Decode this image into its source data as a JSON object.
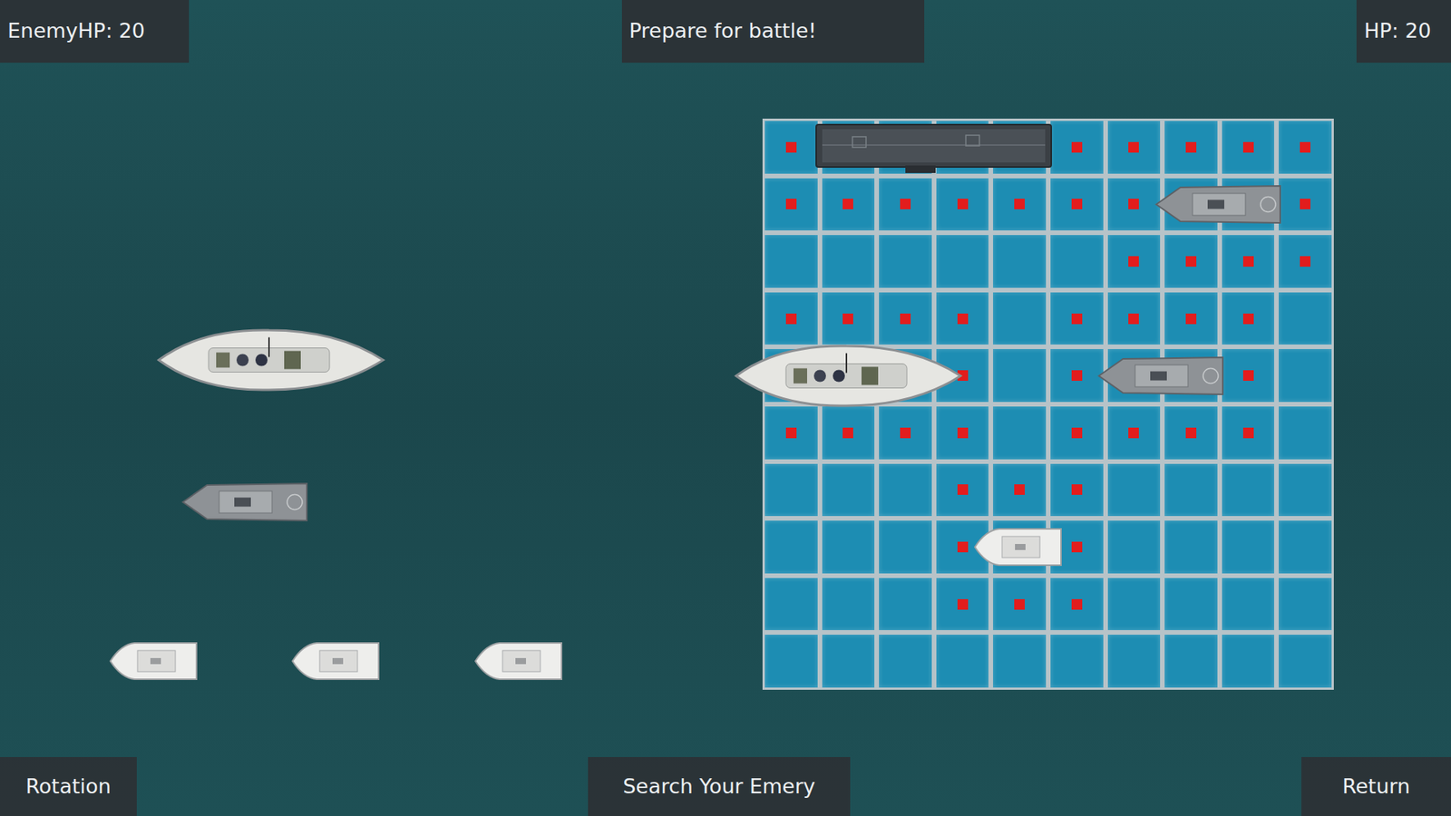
{
  "top_bar": {
    "enemy_hp": "EnemyHP: 20",
    "message": "Prepare for battle!",
    "player_hp": "HP: 20"
  },
  "dock": [
    {
      "kind": "battleship"
    },
    {
      "kind": "cruiser"
    },
    {
      "kind": "boat"
    },
    {
      "kind": "boat"
    },
    {
      "kind": "boat"
    }
  ],
  "board": {
    "size": 10,
    "ships": [
      {
        "kind": "carrier",
        "row": 0,
        "col": 1,
        "length": 4
      },
      {
        "kind": "cruiser",
        "row": 1,
        "col": 7,
        "length": 2
      },
      {
        "kind": "battleship",
        "row": 4,
        "col": 0,
        "length": 3
      },
      {
        "kind": "cruiser",
        "row": 4,
        "col": 6,
        "length": 2
      },
      {
        "kind": "boat",
        "row": 7,
        "col": 4,
        "length": 1
      }
    ],
    "blocked": [
      {
        "row": 0,
        "col": 0
      },
      {
        "row": 0,
        "col": 5
      },
      {
        "row": 0,
        "col": 6
      },
      {
        "row": 0,
        "col": 7
      },
      {
        "row": 0,
        "col": 8
      },
      {
        "row": 0,
        "col": 9
      },
      {
        "row": 1,
        "col": 0
      },
      {
        "row": 1,
        "col": 1
      },
      {
        "row": 1,
        "col": 2
      },
      {
        "row": 1,
        "col": 3
      },
      {
        "row": 1,
        "col": 4
      },
      {
        "row": 1,
        "col": 5
      },
      {
        "row": 1,
        "col": 6
      },
      {
        "row": 1,
        "col": 9
      },
      {
        "row": 2,
        "col": 6
      },
      {
        "row": 2,
        "col": 7
      },
      {
        "row": 2,
        "col": 8
      },
      {
        "row": 2,
        "col": 9
      },
      {
        "row": 3,
        "col": 0
      },
      {
        "row": 3,
        "col": 1
      },
      {
        "row": 3,
        "col": 2
      },
      {
        "row": 3,
        "col": 3
      },
      {
        "row": 3,
        "col": 5
      },
      {
        "row": 3,
        "col": 6
      },
      {
        "row": 3,
        "col": 7
      },
      {
        "row": 3,
        "col": 8
      },
      {
        "row": 4,
        "col": 3
      },
      {
        "row": 4,
        "col": 5
      },
      {
        "row": 4,
        "col": 8
      },
      {
        "row": 5,
        "col": 0
      },
      {
        "row": 5,
        "col": 1
      },
      {
        "row": 5,
        "col": 2
      },
      {
        "row": 5,
        "col": 3
      },
      {
        "row": 5,
        "col": 5
      },
      {
        "row": 5,
        "col": 6
      },
      {
        "row": 5,
        "col": 7
      },
      {
        "row": 5,
        "col": 8
      },
      {
        "row": 6,
        "col": 3
      },
      {
        "row": 6,
        "col": 4
      },
      {
        "row": 6,
        "col": 5
      },
      {
        "row": 7,
        "col": 3
      },
      {
        "row": 7,
        "col": 5
      },
      {
        "row": 8,
        "col": 3
      },
      {
        "row": 8,
        "col": 4
      },
      {
        "row": 8,
        "col": 5
      }
    ]
  },
  "buttons": {
    "rotation": "Rotation",
    "search": "Search Your Emery",
    "return": "Return"
  }
}
